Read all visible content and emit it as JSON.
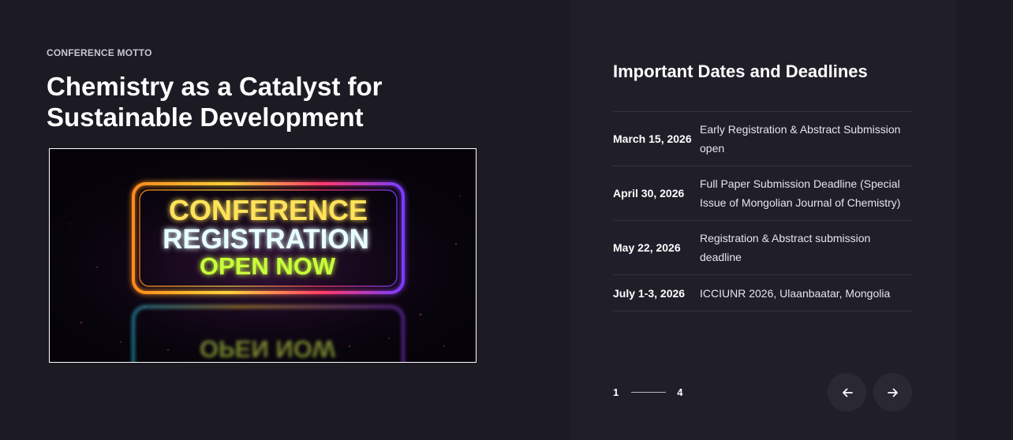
{
  "left": {
    "motto_label": "CONFERENCE MOTTO",
    "headline_line1": "Chemistry as a Catalyst for",
    "headline_line2": "Sustainable Development",
    "banner": {
      "line1": "CONFERENCE",
      "line2": "REGISTRATION",
      "line3": "OPEN NOW",
      "reflection": "OPEN NOW"
    }
  },
  "right": {
    "title": "Important Dates and Deadlines",
    "rows": [
      {
        "date": "March 15, 2026",
        "event": "Early Registration & Abstract Submission open"
      },
      {
        "date": "April 30, 2026",
        "event": "Full Paper Submission Deadline (Special Issue of Mongolian Journal of Chemistry)"
      },
      {
        "date": "May 22, 2026",
        "event": "Registration & Abstract submission deadline"
      },
      {
        "date": "July 1-3, 2026",
        "event": "ICCIUNR 2026, Ulaanbaatar, Mongolia"
      }
    ],
    "pager": {
      "current": "1",
      "total": "4"
    },
    "nav": {
      "prev_icon": "arrow-left-icon",
      "next_icon": "arrow-right-icon"
    }
  },
  "colors": {
    "background": "#1c1b24",
    "panel": "#201f29",
    "neon_yellow": "#ffe25a",
    "neon_cyan": "#e8ffff",
    "neon_green": "#c8ff3a"
  }
}
